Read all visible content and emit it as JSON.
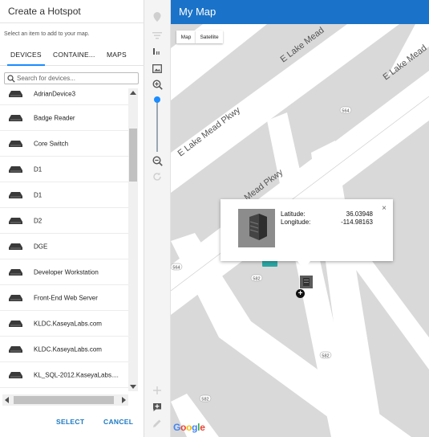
{
  "panel": {
    "title": "Create a Hotspot",
    "subtitle": "Select an item to add to your map.",
    "tabs": [
      {
        "label": "DEVICES",
        "active": true
      },
      {
        "label": "CONTAINE...",
        "active": false
      },
      {
        "label": "MAPS",
        "active": false
      }
    ],
    "search_placeholder": "Search for devices...",
    "items": [
      "AdrianDevice3",
      "Badge Reader",
      "Core Switch",
      "D1",
      "D1",
      "D2",
      "DGE",
      "Developer Workstation",
      "Front-End Web Server",
      "KLDC.KaseyaLabs.com",
      "KLDC.KaseyaLabs.com",
      "KL_SQL-2012.KaseyaLabs...."
    ],
    "select_label": "SELECT",
    "cancel_label": "CANCEL"
  },
  "map": {
    "title": "My Map",
    "type_map": "Map",
    "type_satellite": "Satellite",
    "google": [
      "G",
      "o",
      "o",
      "g",
      "l",
      "e"
    ],
    "google_colors": [
      "#4285f4",
      "#ea4335",
      "#fbbc05",
      "#4285f4",
      "#34a853",
      "#ea4335"
    ],
    "streets": [
      "E Lake Mead",
      "E Lake Mead",
      "E Lake Mead Pkwy",
      "Mead Pkwy"
    ],
    "route_shields": [
      "564",
      "564",
      "582",
      "582",
      "582"
    ],
    "popup": {
      "latitude_label": "Latitude:",
      "latitude": "36.03948",
      "longitude_label": "Longitude:",
      "longitude": "-114.98163",
      "close": "×"
    },
    "marker_plus": "+"
  },
  "tools": [
    "locate-icon",
    "filter-icon",
    "scale-icon",
    "image-icon",
    "zoom-in-icon",
    "zoom-out-icon",
    "refresh-icon",
    "add-icon",
    "comment-icon",
    "edit-icon"
  ],
  "colors": {
    "accent": "#1a8cff",
    "header": "#1a73c8",
    "road": "#ffffff",
    "land": "#d9d9d9",
    "action": "#1b78c2"
  }
}
